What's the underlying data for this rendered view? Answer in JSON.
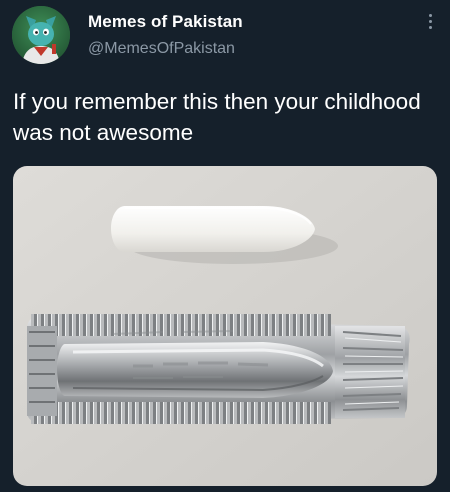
{
  "author": {
    "name": "Memes of Pakistan",
    "handle": "@MemesOfPakistan",
    "avatar_icon": "cartoon-character-avatar"
  },
  "more_icon": "vertical-ellipsis-icon",
  "tweet": {
    "text": "If you remember this then your childhood was not awesome"
  },
  "media": {
    "icon": "suppository-in-foil-photo",
    "description_colors": {
      "background": "#d6d4d0",
      "pill": "#f4f3f0",
      "foil": "#b7b9bb"
    }
  },
  "theme": {
    "background": "#15202b",
    "text": "#ffffff",
    "muted": "#8b98a5"
  }
}
